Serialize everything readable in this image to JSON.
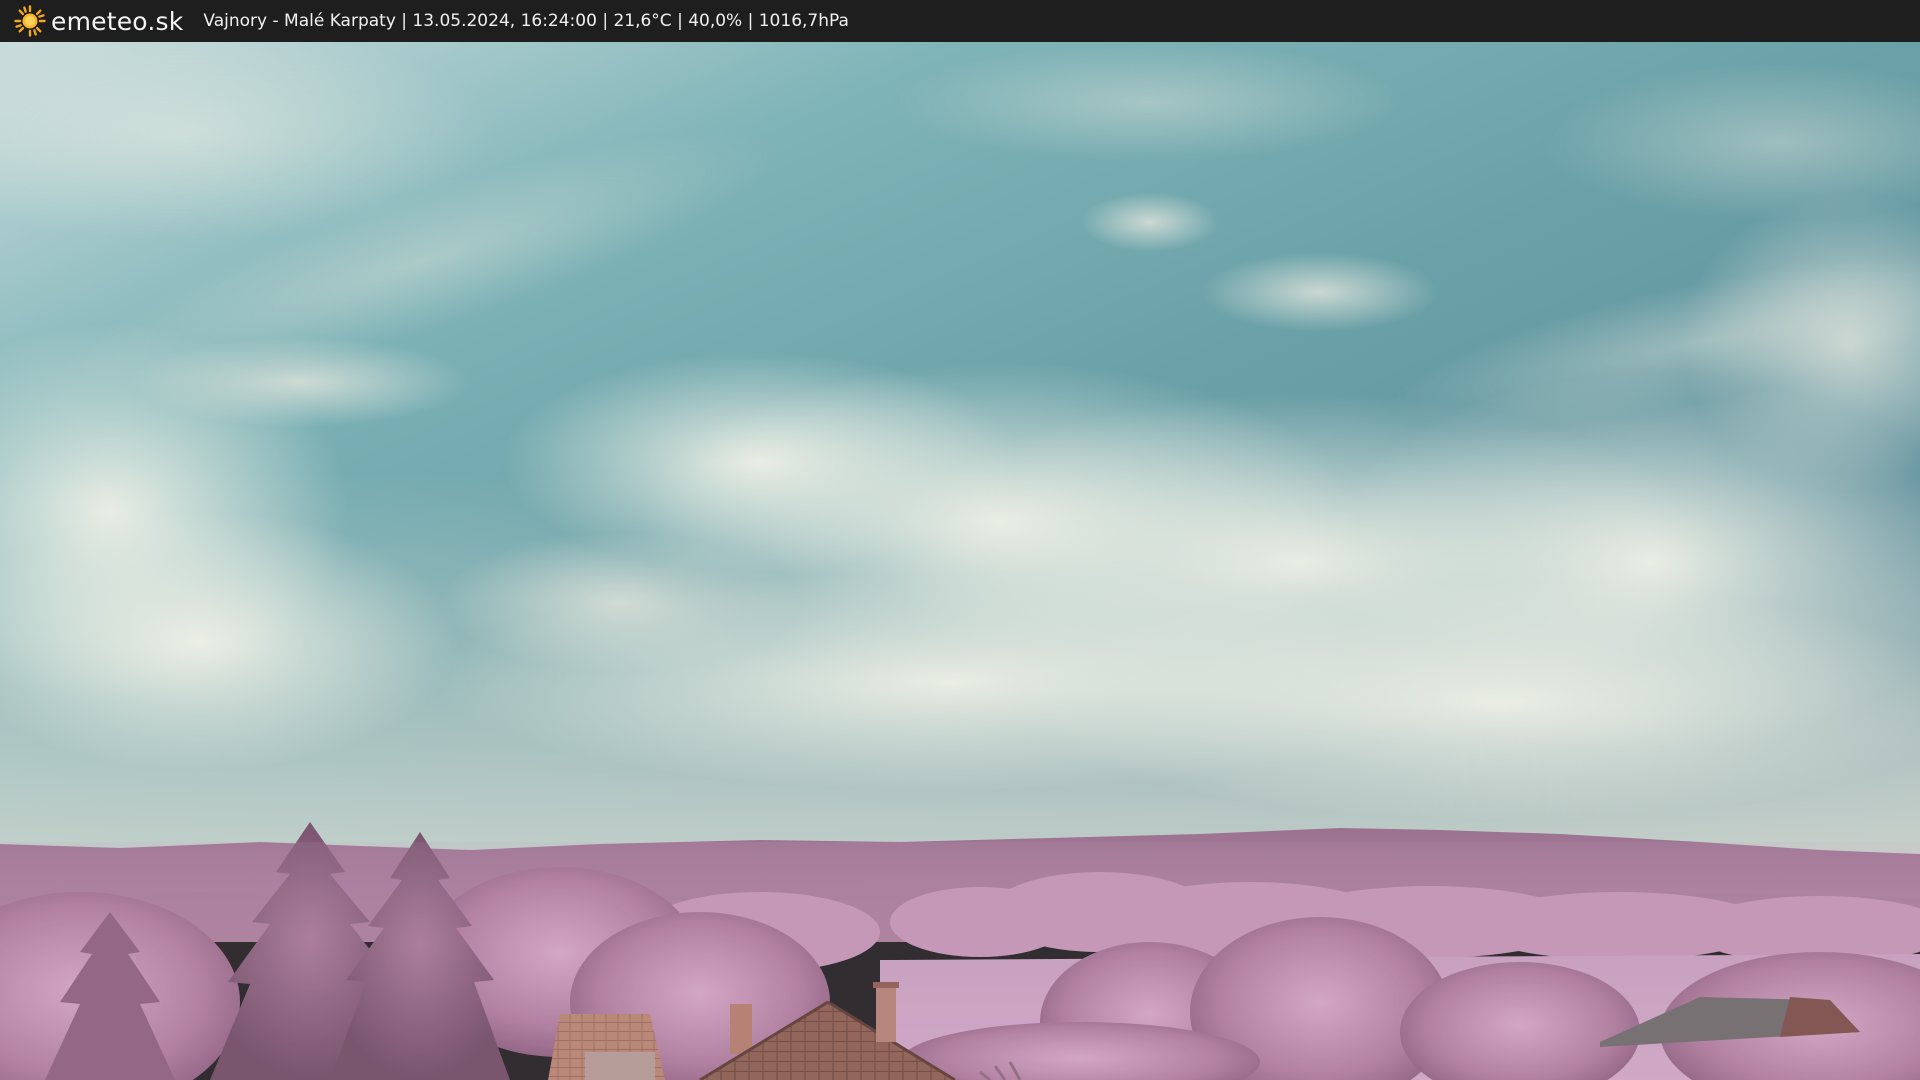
{
  "header": {
    "brand": "emeteo.sk",
    "caption": "Vajnory - Malé Karpaty | 13.05.2024, 16:24:00 | 21,6°C | 40,0% | 1016,7hPa",
    "logo_icon": "sun-icon"
  },
  "colors": {
    "bar": "#1e1e1e",
    "sun": "#f5a623",
    "sky_top": "#8fb7bd",
    "sky_mid": "#6aa3a8",
    "cloud": "#e6e8df",
    "hills": "#9a6c88",
    "foliage": "#c79ab6",
    "field": "#cfa3c4",
    "roof": "#8a5c4e"
  }
}
